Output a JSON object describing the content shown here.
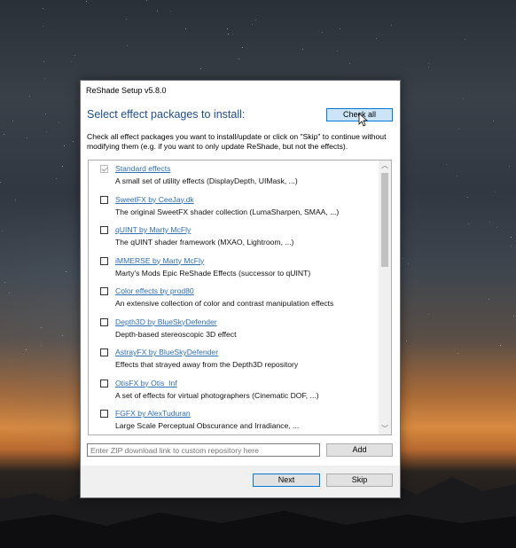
{
  "window": {
    "title": "ReShade Setup v5.8.0"
  },
  "heading": "Select effect packages to install:",
  "buttons": {
    "check_all": "Check all",
    "add": "Add",
    "next": "Next",
    "skip": "Skip"
  },
  "description": "Check all effect packages you want to install/update or click on \"Skip\" to continue without modifying them (e.g. if you want to only update ReShade, but not the effects).",
  "packages": [
    {
      "name": "Standard effects",
      "description": "A small set of utility effects (DisplayDepth, UIMask, ...)",
      "checked": true
    },
    {
      "name": "SweetFX by CeeJay.dk",
      "description": "The original SweetFX shader collection (LumaSharpen, SMAA, ...)",
      "checked": false
    },
    {
      "name": "qUINT by Marty McFly",
      "description": "The qUINT shader framework (MXAO, Lightroom, ...)",
      "checked": false
    },
    {
      "name": "iMMERSE by Marty McFly",
      "description": "Marty's Mods Epic ReShade Effects (successor to qUINT)",
      "checked": false
    },
    {
      "name": "Color effects by prod80",
      "description": "An extensive collection of color and contrast manipulation effects",
      "checked": false
    },
    {
      "name": "Depth3D by BlueSkyDefender",
      "description": "Depth-based stereoscopic 3D effect",
      "checked": false
    },
    {
      "name": "AstrayFX by BlueSkyDefender",
      "description": "Effects that strayed away from the Depth3D repository",
      "checked": false
    },
    {
      "name": "OtisFX by Otis_Inf",
      "description": "A set of effects for virtual photographers (Cinematic DOF, ...)",
      "checked": false
    },
    {
      "name": "FGFX by AlexTuduran",
      "description": "Large Scale Perceptual Obscurance and Irradiance, ...",
      "checked": false
    }
  ],
  "custom_repo": {
    "placeholder": "Enter ZIP download link to custom repository here"
  },
  "colors": {
    "heading": "#1f4e8c",
    "link": "#2f6fb6",
    "focus": "#0078d7"
  }
}
